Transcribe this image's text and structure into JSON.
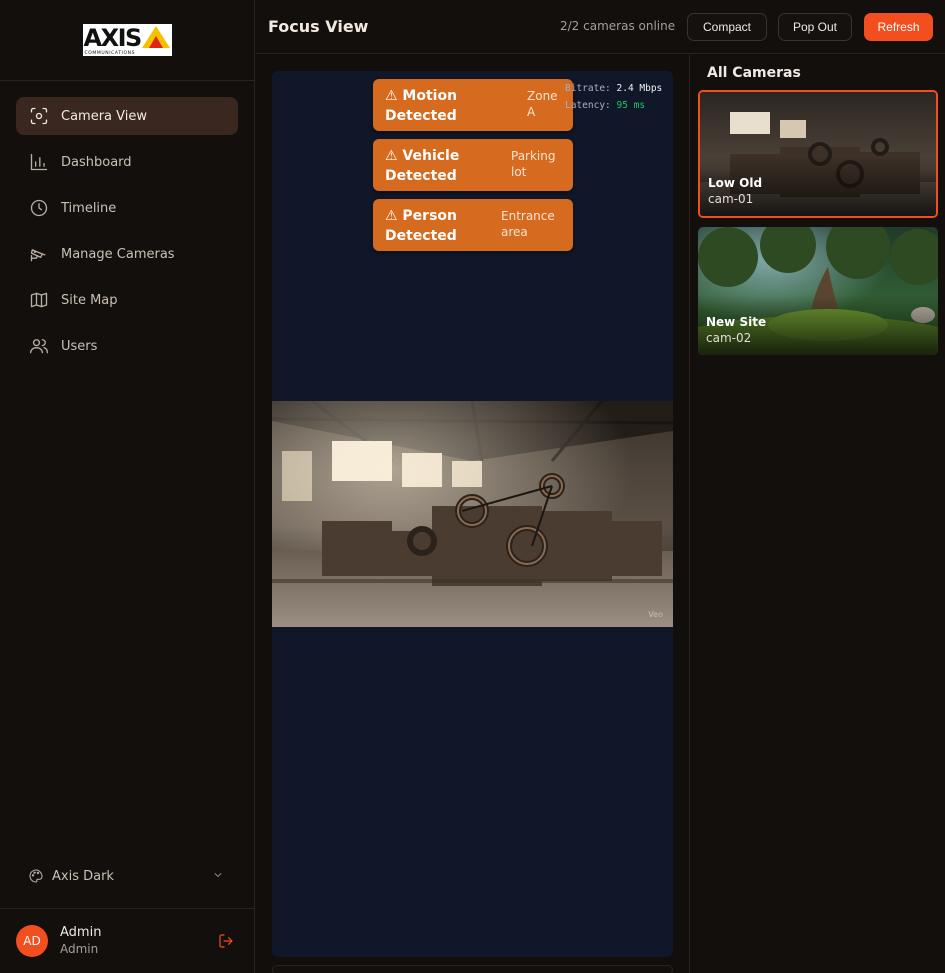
{
  "brand": {
    "logo_text": "AXIS",
    "logo_subtext": "COMMUNICATIONS"
  },
  "sidebar": {
    "items": [
      {
        "label": "Camera View",
        "icon": "camera-view-icon",
        "active": true
      },
      {
        "label": "Dashboard",
        "icon": "bar-chart-icon",
        "active": false
      },
      {
        "label": "Timeline",
        "icon": "clock-icon",
        "active": false
      },
      {
        "label": "Manage Cameras",
        "icon": "cctv-camera-icon",
        "active": false
      },
      {
        "label": "Site Map",
        "icon": "map-icon",
        "active": false
      },
      {
        "label": "Users",
        "icon": "users-icon",
        "active": false
      }
    ],
    "theme_label": "Axis Dark",
    "user": {
      "initials": "AD",
      "name": "Admin",
      "role": "Admin"
    }
  },
  "header": {
    "title": "Focus View",
    "status": "2/2 cameras online",
    "buttons": {
      "compact": "Compact",
      "popout": "Pop Out",
      "refresh": "Refresh"
    }
  },
  "focus": {
    "alerts": [
      {
        "title": "⚠ Motion Detected",
        "zone": "Zone A"
      },
      {
        "title": "⚠ Vehicle Detected",
        "zone": "Parking lot"
      },
      {
        "title": "⚠ Person Detected",
        "zone": "Entrance area"
      }
    ],
    "stats": {
      "bitrate_label": "Bitrate:",
      "bitrate_value": "2.4 Mbps",
      "latency_label": "Latency:",
      "latency_value": "95 ms"
    },
    "watermark": "Veo"
  },
  "panel": {
    "title": "All Cameras",
    "cameras": [
      {
        "name": "Low Old",
        "id": "cam-01",
        "selected": true
      },
      {
        "name": "New Site",
        "id": "cam-02",
        "selected": false
      }
    ]
  },
  "colors": {
    "accent": "#f24e1e",
    "alert": "#d66a1e",
    "stage_bg": "#0f1729",
    "latency_ok": "#22c55e"
  }
}
